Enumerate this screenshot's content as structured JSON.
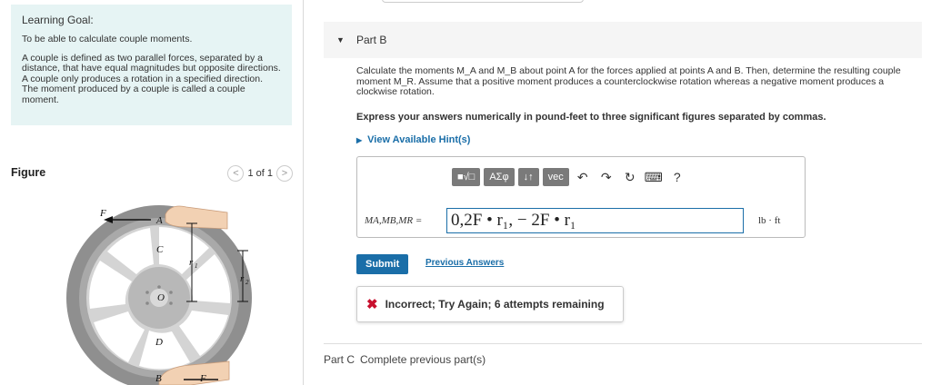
{
  "learning_goal": {
    "heading": "Learning Goal:",
    "p1": "To be able to calculate couple moments.",
    "p2": "A couple is defined as two parallel forces, separated by a distance, that have equal magnitudes but opposite directions. A couple only produces a rotation in a specified direction. The moment produced by a couple is called a couple moment."
  },
  "figure": {
    "title": "Figure",
    "pager": "1 of 1",
    "prev_icon": "<",
    "next_icon": ">",
    "labels": {
      "F_top": "F",
      "A": "A",
      "C": "C",
      "r1": "r",
      "r1_sub": "1",
      "r2": "r",
      "r2_sub": "2",
      "O": "O",
      "D": "D",
      "B": "B",
      "F_bottom": "F"
    }
  },
  "part_b": {
    "label": "Part B",
    "question": "Calculate the moments M_A and M_B about point A for the forces applied at points A and B. Then, determine the resulting couple moment M_R. Assume that a positive moment produces a counterclockwise rotation whereas a negative moment produces a clockwise rotation.",
    "express": "Express your answers numerically in pound-feet to three significant figures separated by commas.",
    "hints": "View Available Hint(s)",
    "toolbar": {
      "templates": "■√□",
      "greek": "ΑΣφ",
      "arrows": "↓↑",
      "vec": "vec",
      "undo": "↶",
      "redo": "↷",
      "reset": "↻",
      "keyboard": "⌨",
      "help": "?"
    },
    "answer_label": "MA,MB,MR =",
    "answer_value": "0,2F • r₁, − 2F • r₁",
    "unit": "lb · ft",
    "submit": "Submit",
    "previous_answers": "Previous Answers",
    "feedback": "Incorrect; Try Again; 6 attempts remaining"
  },
  "part_c": {
    "label": "Part C",
    "text": "Complete previous part(s)"
  },
  "colors": {
    "accent": "#1a6ea8",
    "error": "#c8102e",
    "goal_bg": "#e6f4f4"
  }
}
